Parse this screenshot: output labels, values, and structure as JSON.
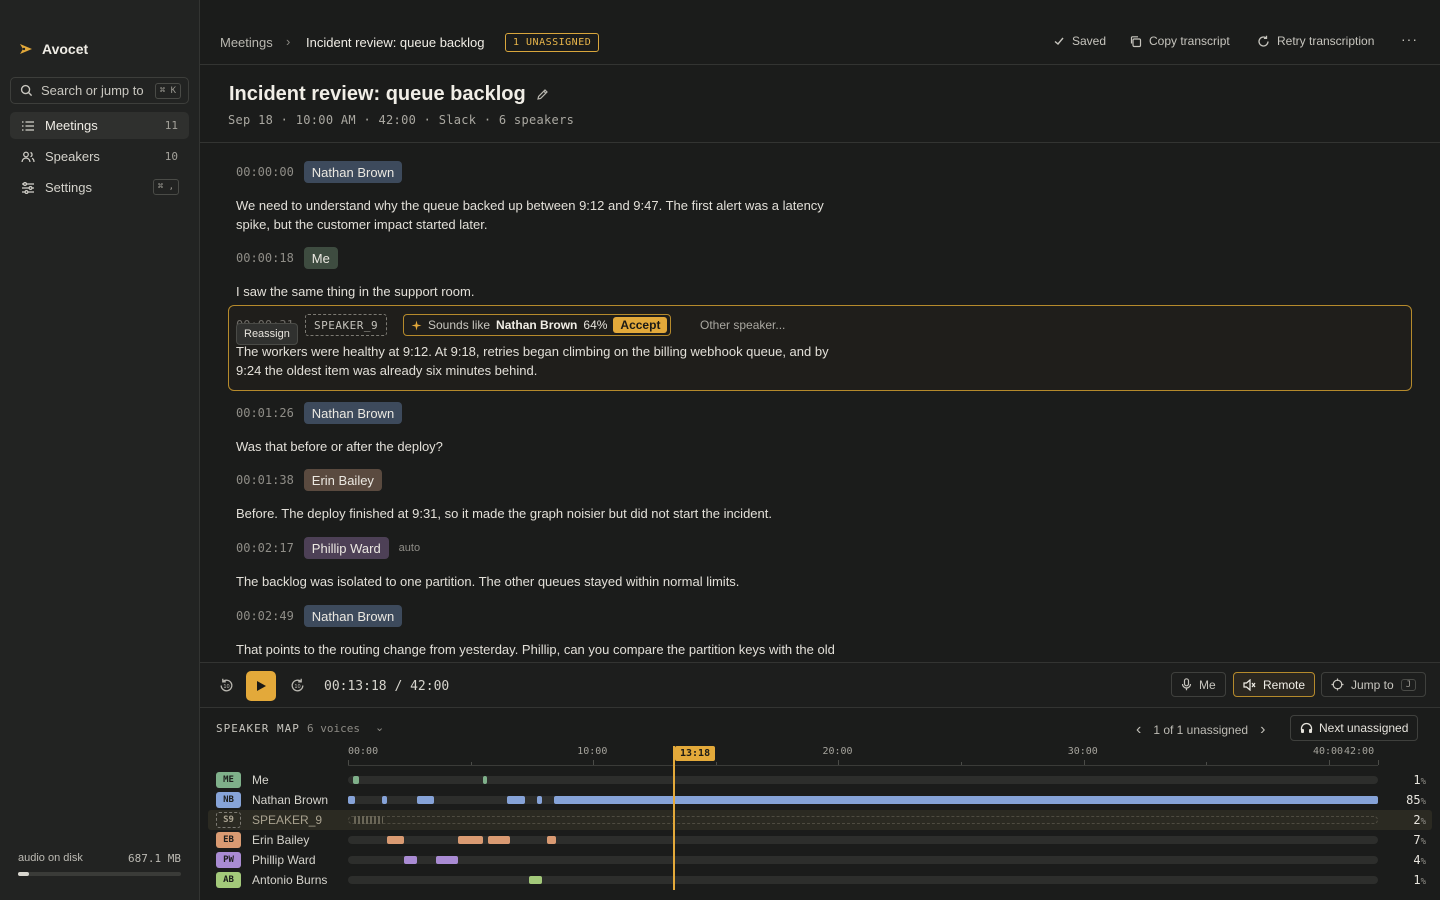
{
  "app": {
    "name": "Avocet"
  },
  "sidebar": {
    "search_placeholder": "Search or jump to",
    "search_shortcut": "⌘ K",
    "items": [
      {
        "label": "Meetings",
        "count": "11",
        "active": true,
        "icon": "list-icon"
      },
      {
        "label": "Speakers",
        "count": "10",
        "active": false,
        "icon": "users-icon"
      },
      {
        "label": "Settings",
        "shortcut": "⌘ ,",
        "active": false,
        "icon": "sliders-icon"
      }
    ],
    "disk": {
      "label": "audio on disk",
      "value": "687.1 MB",
      "usage_fraction": 0.07
    }
  },
  "topbar": {
    "breadcrumb_root": "Meetings",
    "breadcrumb_current": "Incident review: queue backlog",
    "unassigned_badge": "1 UNASSIGNED",
    "saved": "Saved",
    "copy": "Copy transcript",
    "retry": "Retry transcription"
  },
  "meeting": {
    "title": "Incident review: queue backlog",
    "meta": "Sep 18 · 10:00 AM · 42:00 · Slack · 6 speakers"
  },
  "transcript": [
    {
      "ts": "00:00:00",
      "speaker": "Nathan Brown",
      "text": "We need to understand why the queue backed up between 9:12 and 9:47. The first alert was a latency spike, but the customer impact started later."
    },
    {
      "ts": "00:00:18",
      "speaker": "Me",
      "text": "I saw the same thing in the support room."
    },
    {
      "ts": "00:00:31",
      "speaker": "SPEAKER_9",
      "reassign": "Reassign",
      "suggest_prefix": "Sounds like",
      "suggest_name": "Nathan Brown",
      "suggest_pct": "64%",
      "accept": "Accept",
      "other": "Other speaker...",
      "text": "The workers were healthy at 9:12. At 9:18, retries began climbing on the billing webhook queue, and by 9:24 the oldest item was already six minutes behind."
    },
    {
      "ts": "00:01:26",
      "speaker": "Nathan Brown",
      "text": "Was that before or after the deploy?"
    },
    {
      "ts": "00:01:38",
      "speaker": "Erin Bailey",
      "text": "Before. The deploy finished at 9:31, so it made the graph noisier but did not start the incident."
    },
    {
      "ts": "00:02:17",
      "speaker": "Phillip Ward",
      "tag": "auto",
      "text": "The backlog was isolated to one partition. The other queues stayed within normal limits."
    },
    {
      "ts": "00:02:49",
      "speaker": "Nathan Brown",
      "text": "That points to the routing change from yesterday. Phillip, can you compare the partition keys with the old consumer logs?"
    }
  ],
  "player": {
    "timecode": "00:13:18 / 42:00",
    "me_label": "Me",
    "remote_label": "Remote",
    "jump_label": "Jump to",
    "jump_key": "J"
  },
  "speaker_map": {
    "title": "SPEAKER MAP",
    "voices": "6 voices",
    "unassigned_nav": "1 of 1 unassigned",
    "next_label": "Next unassigned",
    "ticks": [
      "00:00",
      "10:00",
      "20:00",
      "30:00",
      "40:00",
      "42:00"
    ],
    "playhead_label": "13:18",
    "duration_min": 42,
    "playhead_min": 13.3,
    "speakers": [
      {
        "initials": "ME",
        "name": "Me",
        "pct": "1",
        "color": "#7fb08a",
        "segments": [
          [
            0.2,
            0.45
          ],
          [
            5.5,
            5.65
          ]
        ]
      },
      {
        "initials": "NB",
        "name": "Nathan Brown",
        "pct": "85",
        "color": "#86a3d8",
        "segments": [
          [
            0,
            0.3
          ],
          [
            1.4,
            1.6
          ],
          [
            2.8,
            3.5
          ],
          [
            6.5,
            7.2
          ],
          [
            7.7,
            7.9
          ],
          [
            8.4,
            42
          ]
        ]
      },
      {
        "initials": "S9",
        "name": "SPEAKER_9",
        "pct": "2",
        "color": "#6a6657",
        "selected": true,
        "segments": [
          [
            0.2,
            1.4
          ]
        ]
      },
      {
        "initials": "EB",
        "name": "Erin Bailey",
        "pct": "7",
        "color": "#d99a72",
        "segments": [
          [
            1.6,
            2.3
          ],
          [
            4.5,
            5.5
          ],
          [
            5.7,
            6.6
          ],
          [
            8.1,
            8.5
          ]
        ]
      },
      {
        "initials": "PW",
        "name": "Phillip Ward",
        "pct": "4",
        "color": "#a98bd3",
        "segments": [
          [
            2.3,
            2.8
          ],
          [
            3.6,
            4.5
          ]
        ]
      },
      {
        "initials": "AB",
        "name": "Antonio Burns",
        "pct": "1",
        "color": "#a3c97a",
        "segments": [
          [
            7.4,
            7.9
          ]
        ]
      }
    ]
  }
}
